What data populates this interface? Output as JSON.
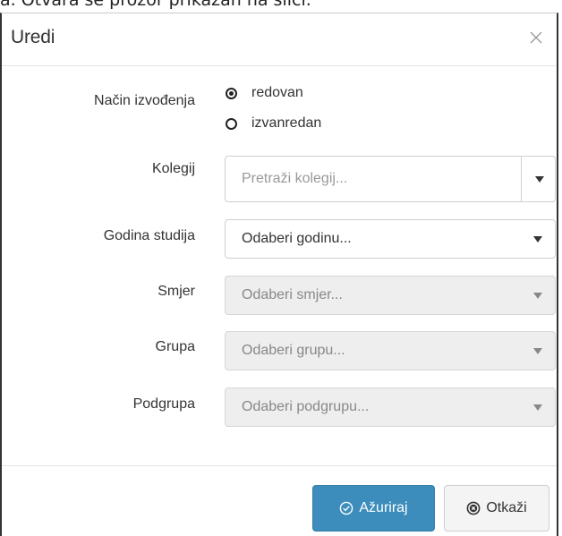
{
  "caption": "a. Otvara se prozor prikazan na slici.",
  "dialog": {
    "title": "Uredi",
    "close_symbol": "×"
  },
  "form": {
    "nacin": {
      "label": "Način izvođenja",
      "options": [
        {
          "label": "redovan",
          "checked": true
        },
        {
          "label": "izvanredan",
          "checked": false
        }
      ]
    },
    "kolegij": {
      "label": "Kolegij",
      "placeholder": "Pretraži kolegij..."
    },
    "godina": {
      "label": "Godina studija",
      "value": "Odaberi godinu...",
      "disabled": false
    },
    "smjer": {
      "label": "Smjer",
      "value": "Odaberi smjer...",
      "disabled": true
    },
    "grupa": {
      "label": "Grupa",
      "value": "Odaberi grupu...",
      "disabled": true
    },
    "podgrupa": {
      "label": "Podgrupa",
      "value": "Odaberi podgrupu...",
      "disabled": true
    }
  },
  "footer": {
    "update_label": "Ažuriraj",
    "cancel_label": "Otkaži"
  },
  "icons": {
    "update": "check-circle-icon",
    "cancel": "times-circle-icon",
    "close": "close-icon"
  },
  "colors": {
    "primary": "#3c8dbc",
    "disabled_bg": "#eeeeee"
  }
}
